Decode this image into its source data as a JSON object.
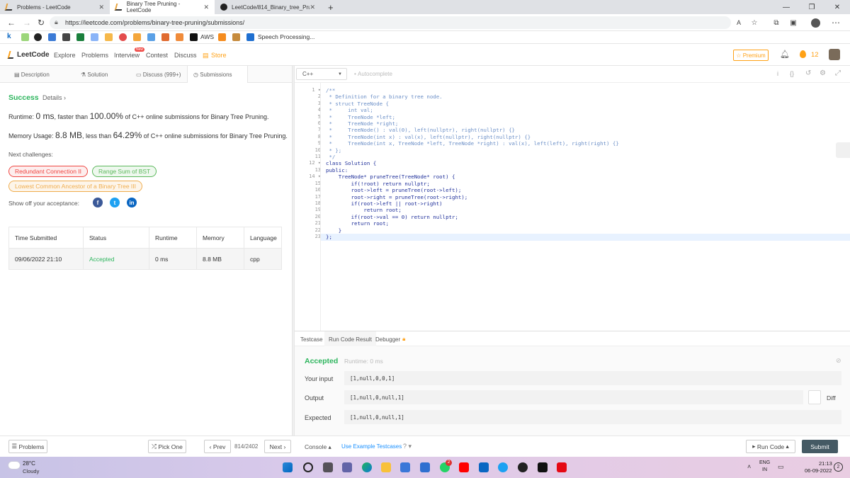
{
  "browser": {
    "tabs": [
      {
        "title": "Problems - LeetCode",
        "close": "✕"
      },
      {
        "title": "Binary Tree Pruning - LeetCode",
        "close": "✕"
      },
      {
        "title": "LeetCode/814_Binary_tree_Prun...",
        "close": "✕"
      }
    ],
    "new_tab": "+",
    "url": "https://leetcode.com/problems/binary-tree-pruning/submissions/",
    "bookmarks": {
      "aws": "AWS",
      "speech": "Speech Processing..."
    },
    "window_controls": {
      "minimize": "—",
      "restore": "❐",
      "close": "✕"
    }
  },
  "nav": {
    "logo": "LeetCode",
    "items": [
      "Explore",
      "Problems",
      "Interview",
      "Contest",
      "Discuss"
    ],
    "new_badge": "New",
    "store": "Store",
    "premium": "Premium",
    "streak": "12"
  },
  "subtabs": [
    "Description",
    "Solution",
    "Discuss (999+)",
    "Submissions"
  ],
  "result_panel": {
    "status": "Success",
    "details": "Details",
    "runtime_prefix": "Runtime: ",
    "runtime_value": "0 ms",
    "runtime_mid": ", faster than ",
    "runtime_pct": "100.00%",
    "runtime_suffix": " of C++ online submissions for Binary Tree Pruning.",
    "memory_prefix": "Memory Usage: ",
    "memory_value": "8.8 MB",
    "memory_mid": ", less than ",
    "memory_pct": "64.29%",
    "memory_suffix": " of C++ online submissions for Binary Tree Pruning.",
    "next_challenges": "Next challenges:",
    "challenges": [
      "Redundant Connection II",
      "Range Sum of BST",
      "Lowest Common Ancestor of a Binary Tree III"
    ],
    "show_off": "Show off your acceptance:"
  },
  "table": {
    "headers": [
      "Time Submitted",
      "Status",
      "Runtime",
      "Memory",
      "Language"
    ],
    "rows": [
      [
        "09/06/2022 21:10",
        "Accepted",
        "0 ms",
        "8.8 MB",
        "cpp"
      ]
    ]
  },
  "editor": {
    "language": "C++",
    "autocomplete": "Autocomplete",
    "lines": [
      "/**",
      " * Definition for a binary tree node.",
      " * struct TreeNode {",
      " *     int val;",
      " *     TreeNode *left;",
      " *     TreeNode *right;",
      " *     TreeNode() : val(0), left(nullptr), right(nullptr) {}",
      " *     TreeNode(int x) : val(x), left(nullptr), right(nullptr) {}",
      " *     TreeNode(int x, TreeNode *left, TreeNode *right) : val(x), left(left), right(right) {}",
      " * };",
      " */",
      "class Solution {",
      "public:",
      "    TreeNode* pruneTree(TreeNode* root) {",
      "        if(!root) return nullptr;",
      "        root->left = pruneTree(root->left);",
      "        root->right = pruneTree(root->right);",
      "        if(root->left || root->right)",
      "            return root;",
      "        if(root->val == 0) return nullptr;",
      "        return root;",
      "    }",
      "};"
    ]
  },
  "console": {
    "tabs": [
      "Testcase",
      "Run Code Result",
      "Debugger"
    ],
    "status": "Accepted",
    "runtime": "Runtime: 0 ms",
    "your_input_label": "Your input",
    "your_input": "[1,null,0,0,1]",
    "output_label": "Output",
    "output": "[1,null,0,null,1]",
    "expected_label": "Expected",
    "expected": "[1,null,0,null,1]",
    "diff": "Diff"
  },
  "bottom": {
    "problems": "Problems",
    "pick_one": "Pick One",
    "prev": "Prev",
    "page": "814/2402",
    "next": "Next",
    "console": "Console",
    "use_example": "Use Example Testcases",
    "run_code": "Run Code",
    "submit": "Submit"
  },
  "taskbar": {
    "temp": "28°C",
    "weather": "Cloudy",
    "lang1": "ENG",
    "lang2": "IN",
    "time": "21:13",
    "date": "06-09-2022",
    "badge": "2"
  },
  "colors": {
    "green": "#2db55d",
    "orange": "#ffa116",
    "accent": "#1a90ff",
    "submit": "#455a64"
  }
}
